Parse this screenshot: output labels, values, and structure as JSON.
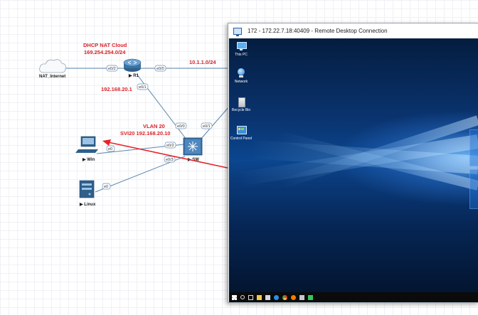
{
  "topology": {
    "cloud": {
      "label": "NAT_Internet"
    },
    "router": {
      "label": "R1"
    },
    "switch": {
      "label": "SW"
    },
    "win_host": {
      "label": "Win"
    },
    "linux_host": {
      "label": "Linux"
    },
    "annotations": {
      "dhcp_line1": "DHCP NAT Cloud",
      "dhcp_line2": "169.254.254.0/24",
      "subnet": "10.1.1.0/24",
      "r1_ip": "192.168.20.1",
      "vlan": "VLAN 20",
      "svi": "SVI20 192.168.20.10"
    },
    "interfaces": {
      "r1_to_cloud": "e0/2",
      "r1_to_rdp": "e0/0",
      "r1_to_sw": "e0/1",
      "sw_to_r1": "e0/0",
      "sw_to_rdp": "e0/1",
      "sw_to_win": "e0/2",
      "sw_to_linux": "e0/3",
      "win_nic": "e0",
      "linux_nic": "e0"
    },
    "arrow_color": "#e8222a"
  },
  "rdp": {
    "title": "172 - 172.22.7.18:40409 - Remote Desktop Connection",
    "desktop_icons": [
      {
        "label": "This PC",
        "icon": "monitor-icon"
      },
      {
        "label": "Network",
        "icon": "network-icon"
      },
      {
        "label": "Recycle Bin",
        "icon": "recycle-bin-icon"
      },
      {
        "label": "Control Panel",
        "icon": "control-panel-icon"
      }
    ],
    "taskbar_icons": [
      "windows-start-icon",
      "search-icon",
      "task-view-icon",
      "explorer-icon",
      "store-icon",
      "edge-icon",
      "chrome-icon",
      "firefox-icon",
      "tool-icon",
      "app-icon"
    ]
  }
}
